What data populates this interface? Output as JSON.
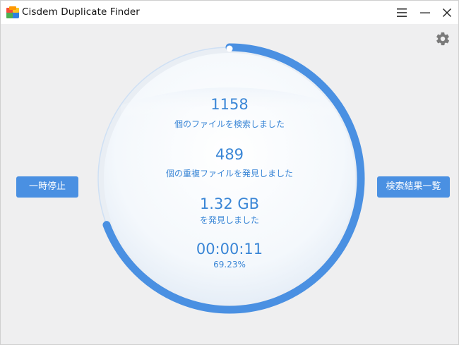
{
  "window": {
    "title": "Cisdem Duplicate Finder"
  },
  "controls": {
    "menu_icon": "hamburger-menu-icon",
    "minimize_icon": "minimize-icon",
    "close_icon": "close-icon",
    "settings_icon": "gear-icon"
  },
  "buttons": {
    "pause_label": "一時停止",
    "results_label": "検索結果一覧"
  },
  "stats": {
    "files_scanned": "1158",
    "files_scanned_label": "個のファイルを検索しました",
    "duplicates_found": "489",
    "duplicates_found_label": "個の重複ファイルを発見しました",
    "size_found": "1.32 GB",
    "size_found_label": "を発見しました",
    "elapsed_time": "00:00:11",
    "progress_text": "69.23%"
  },
  "progress": {
    "fraction": 0.6923
  },
  "colors": {
    "accent": "#4a90e2",
    "text_accent": "#3a86d6",
    "ring_track": "#d7e6f7",
    "background": "#efeff0"
  }
}
